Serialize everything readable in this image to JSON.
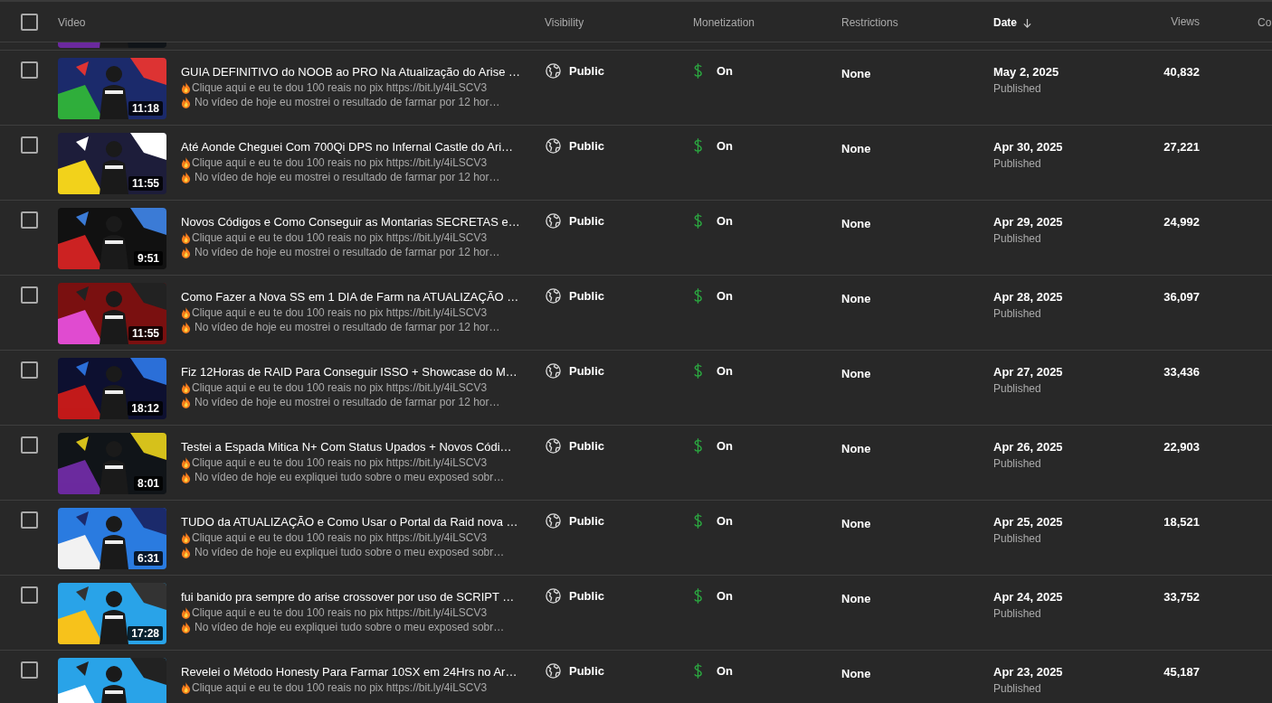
{
  "header": {
    "select_all": {
      "checked": false
    },
    "columns": [
      {
        "label": "Video",
        "sorted": false
      },
      {
        "label": "Visibility",
        "sorted": false
      },
      {
        "label": "Monetization",
        "sorted": false
      },
      {
        "label": "Restrictions",
        "sorted": false
      },
      {
        "label": "Date",
        "sorted": true
      },
      {
        "label": "Views",
        "sorted": false
      },
      {
        "label": "Co",
        "sorted": false
      }
    ]
  },
  "rows": [
    {
      "checked": false,
      "duration": "11:18",
      "title": "GUIA DEFINITIVO do NOOB ao PRO Na Atualização do Arise …",
      "description": [
        "Clique aqui e eu te dou 100 reais no pix https://bit.ly/4iLSCV3",
        "No vídeo de hoje eu mostrei o resultado de farmar por 12 hor…"
      ],
      "visibility": "Public",
      "monetization": "On",
      "restrictions": "None",
      "date": "May 2, 2025",
      "status": "Published",
      "views": "40,832"
    },
    {
      "checked": false,
      "duration": "11:55",
      "title": "Até Aonde Cheguei Com 700Qi DPS no Infernal Castle do Ari…",
      "description": [
        "Clique aqui e eu te dou 100 reais no pix https://bit.ly/4iLSCV3",
        "No vídeo de hoje eu mostrei o resultado de farmar por 12 hor…"
      ],
      "visibility": "Public",
      "monetization": "On",
      "restrictions": "None",
      "date": "Apr 30, 2025",
      "status": "Published",
      "views": "27,221"
    },
    {
      "checked": false,
      "duration": "9:51",
      "title": "Novos Códigos e Como Conseguir as Montarias SECRETAS e…",
      "description": [
        "Clique aqui e eu te dou 100 reais no pix https://bit.ly/4iLSCV3",
        "No vídeo de hoje eu mostrei o resultado de farmar por 12 hor…"
      ],
      "visibility": "Public",
      "monetization": "On",
      "restrictions": "None",
      "date": "Apr 29, 2025",
      "status": "Published",
      "views": "24,992"
    },
    {
      "checked": false,
      "duration": "11:55",
      "title": "Como Fazer a Nova SS em 1 DIA de Farm na ATUALIZAÇÃO …",
      "description": [
        "Clique aqui e eu te dou 100 reais no pix https://bit.ly/4iLSCV3",
        "No vídeo de hoje eu mostrei o resultado de farmar por 12 hor…"
      ],
      "visibility": "Public",
      "monetization": "On",
      "restrictions": "None",
      "date": "Apr 28, 2025",
      "status": "Published",
      "views": "36,097"
    },
    {
      "checked": false,
      "duration": "18:12",
      "title": "Fiz 12Horas de RAID Para Conseguir ISSO + Showcase do M…",
      "description": [
        "Clique aqui e eu te dou 100 reais no pix https://bit.ly/4iLSCV3",
        "No vídeo de hoje eu mostrei o resultado de farmar por 12 hor…"
      ],
      "visibility": "Public",
      "monetization": "On",
      "restrictions": "None",
      "date": "Apr 27, 2025",
      "status": "Published",
      "views": "33,436"
    },
    {
      "checked": false,
      "duration": "8:01",
      "title": "Testei a Espada Mitica N+ Com Status Upados + Novos Códi…",
      "description": [
        "Clique aqui e eu te dou 100 reais no pix https://bit.ly/4iLSCV3",
        "No vídeo de hoje eu expliquei tudo sobre o meu exposed sobr…"
      ],
      "visibility": "Public",
      "monetization": "On",
      "restrictions": "None",
      "date": "Apr 26, 2025",
      "status": "Published",
      "views": "22,903"
    },
    {
      "checked": false,
      "duration": "6:31",
      "title": "TUDO da ATUALIZAÇÃO e Como Usar o Portal da Raid nova …",
      "description": [
        "Clique aqui e eu te dou 100 reais no pix https://bit.ly/4iLSCV3",
        "No vídeo de hoje eu expliquei tudo sobre o meu exposed sobr…"
      ],
      "visibility": "Public",
      "monetization": "On",
      "restrictions": "None",
      "date": "Apr 25, 2025",
      "status": "Published",
      "views": "18,521"
    },
    {
      "checked": false,
      "duration": "17:28",
      "title": "fui banido pra sempre do arise crossover por uso de SCRIPT …",
      "description": [
        "Clique aqui e eu te dou 100 reais no pix https://bit.ly/4iLSCV3",
        "No vídeo de hoje eu expliquei tudo sobre o meu exposed sobr…"
      ],
      "visibility": "Public",
      "monetization": "On",
      "restrictions": "None",
      "date": "Apr 24, 2025",
      "status": "Published",
      "views": "33,752"
    },
    {
      "checked": false,
      "title": "Revelei o Método Honesty Para Farmar 10SX em 24Hrs no Ar…",
      "description": [
        "Clique aqui e eu te dou 100 reais no pix https://bit.ly/4iLSCV3"
      ],
      "visibility": "Public",
      "monetization": "On",
      "restrictions": "None",
      "date": "Apr 23, 2025",
      "status": "Published",
      "views": "45,187"
    }
  ]
}
